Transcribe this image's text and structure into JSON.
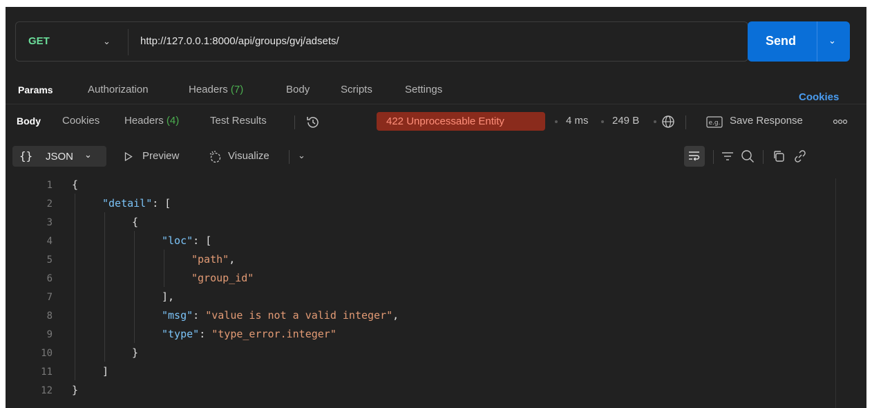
{
  "request": {
    "method": "GET",
    "url": "http://127.0.0.1:8000/api/groups/gvj/adsets/",
    "send_label": "Send"
  },
  "request_tabs": {
    "params": "Params",
    "authorization": "Authorization",
    "headers": "Headers",
    "headers_count": "(7)",
    "body": "Body",
    "scripts": "Scripts",
    "settings": "Settings",
    "cookies": "Cookies"
  },
  "response_tabs": {
    "body": "Body",
    "cookies": "Cookies",
    "headers": "Headers",
    "headers_count": "(4)",
    "test_results": "Test Results"
  },
  "response_meta": {
    "status": "422 Unprocessable Entity",
    "time": "4 ms",
    "size": "249 B",
    "save_response": "Save Response"
  },
  "toolbar": {
    "format": "JSON",
    "preview": "Preview",
    "visualize": "Visualize"
  },
  "code": {
    "line_numbers": [
      "1",
      "2",
      "3",
      "4",
      "5",
      "6",
      "7",
      "8",
      "9",
      "10",
      "11",
      "12"
    ],
    "k_detail": "\"detail\"",
    "k_loc": "\"loc\"",
    "v_path": "\"path\"",
    "v_group_id": "\"group_id\"",
    "k_msg": "\"msg\"",
    "v_msg": "\"value is not a valid integer\"",
    "k_type": "\"type\"",
    "v_type": "\"type_error.integer\""
  }
}
